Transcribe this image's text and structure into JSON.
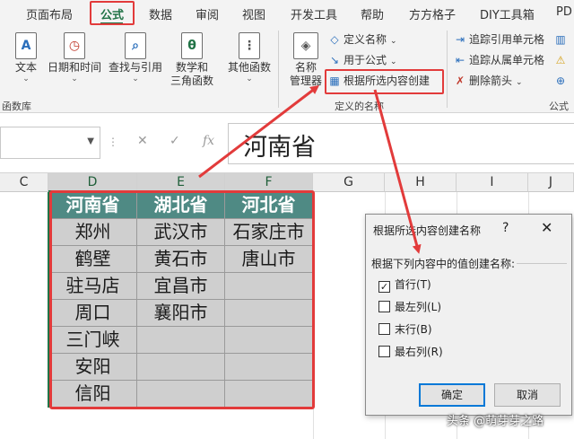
{
  "ribbon_tabs": [
    "页面布局",
    "公式",
    "数据",
    "审阅",
    "视图",
    "开发工具",
    "帮助",
    "方方格子",
    "DIY工具箱",
    "PD"
  ],
  "active_tab": "公式",
  "function_library": {
    "buttons": [
      {
        "label": "文本",
        "icon": "text-icon"
      },
      {
        "label": "日期和时间",
        "icon": "clock-icon"
      },
      {
        "label": "查找与引用",
        "icon": "magnifier-icon"
      },
      {
        "label": "数学和",
        "label2": "三角函数",
        "icon": "theta-icon"
      },
      {
        "label": "其他函数",
        "icon": "more-functions-icon"
      }
    ],
    "group_label": "函数库"
  },
  "defined_names": {
    "name_manager": {
      "label": "名称",
      "label2": "管理器"
    },
    "define_name": "定义名称",
    "use_in_formula": "用于公式",
    "create_from_selection": "根据所选内容创建",
    "group_label": "定义的名称"
  },
  "formula_auditing": {
    "trace_precedents": "追踪引用单元格",
    "trace_dependents": "追踪从属单元格",
    "remove_arrows": "删除箭头",
    "group_label": "公式"
  },
  "formula_bar": {
    "cancel": "✕",
    "enter": "✓",
    "fx": "fx",
    "value": "河南省"
  },
  "columns": [
    "C",
    "D",
    "E",
    "F",
    "G",
    "H",
    "I",
    "J"
  ],
  "table": {
    "headers": [
      "河南省",
      "湖北省",
      "河北省"
    ],
    "rows": [
      [
        "郑州",
        "武汉市",
        "石家庄市"
      ],
      [
        "鹤壁",
        "黄石市",
        "唐山市"
      ],
      [
        "驻马店",
        "宜昌市",
        ""
      ],
      [
        "周口",
        "襄阳市",
        ""
      ],
      [
        "三门峡",
        "",
        ""
      ],
      [
        "安阳",
        "",
        ""
      ],
      [
        "信阳",
        "",
        ""
      ]
    ]
  },
  "dialog": {
    "title": "根据所选内容创建名称",
    "help": "?",
    "close": "✕",
    "caption": "根据下列内容中的值创建名称:",
    "options": [
      {
        "label": "首行(T)",
        "checked": true
      },
      {
        "label": "最左列(L)",
        "checked": false
      },
      {
        "label": "末行(B)",
        "checked": false
      },
      {
        "label": "最右列(R)",
        "checked": false
      }
    ],
    "ok": "确定",
    "cancel": "取消"
  },
  "watermark": "头条 @萌芽芽之路",
  "colors": {
    "accent": "#217346",
    "table_header": "#4f8a84",
    "cell_fill": "#cfcfcf",
    "highlight": "#e23b3b"
  }
}
